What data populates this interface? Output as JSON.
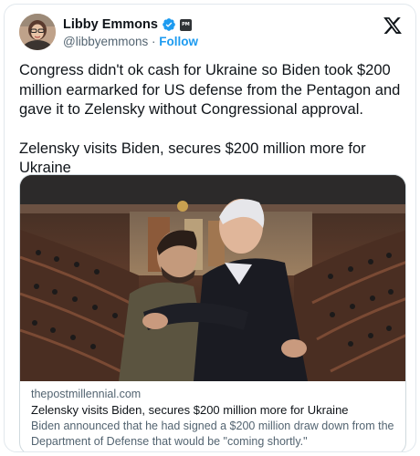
{
  "author": {
    "display_name": "Libby Emmons",
    "handle": "@libbyemmons",
    "separator": "·",
    "follow_label": "Follow",
    "affiliation_badge": "PM"
  },
  "icons": {
    "verified": "verified-badge-icon",
    "platform": "x-logo-icon"
  },
  "colors": {
    "accent": "#1d9bf0",
    "text": "#0f1419",
    "secondary": "#536471"
  },
  "tweet": {
    "paragraph_1": "Congress didn't ok cash for Ukraine so Biden took $200 million earmarked for US defense from the Pentagon and gave it to Zelensky without Congressional approval.",
    "paragraph_2": "Zelensky visits Biden, secures $200 million more for Ukraine"
  },
  "link_card": {
    "domain": "thepostmillennial.com",
    "title": "Zelensky visits Biden, secures $200 million more for Ukraine",
    "description": "Biden announced that he had signed a $200 million draw down from the Department of Defense that would be \"coming shortly.\""
  }
}
